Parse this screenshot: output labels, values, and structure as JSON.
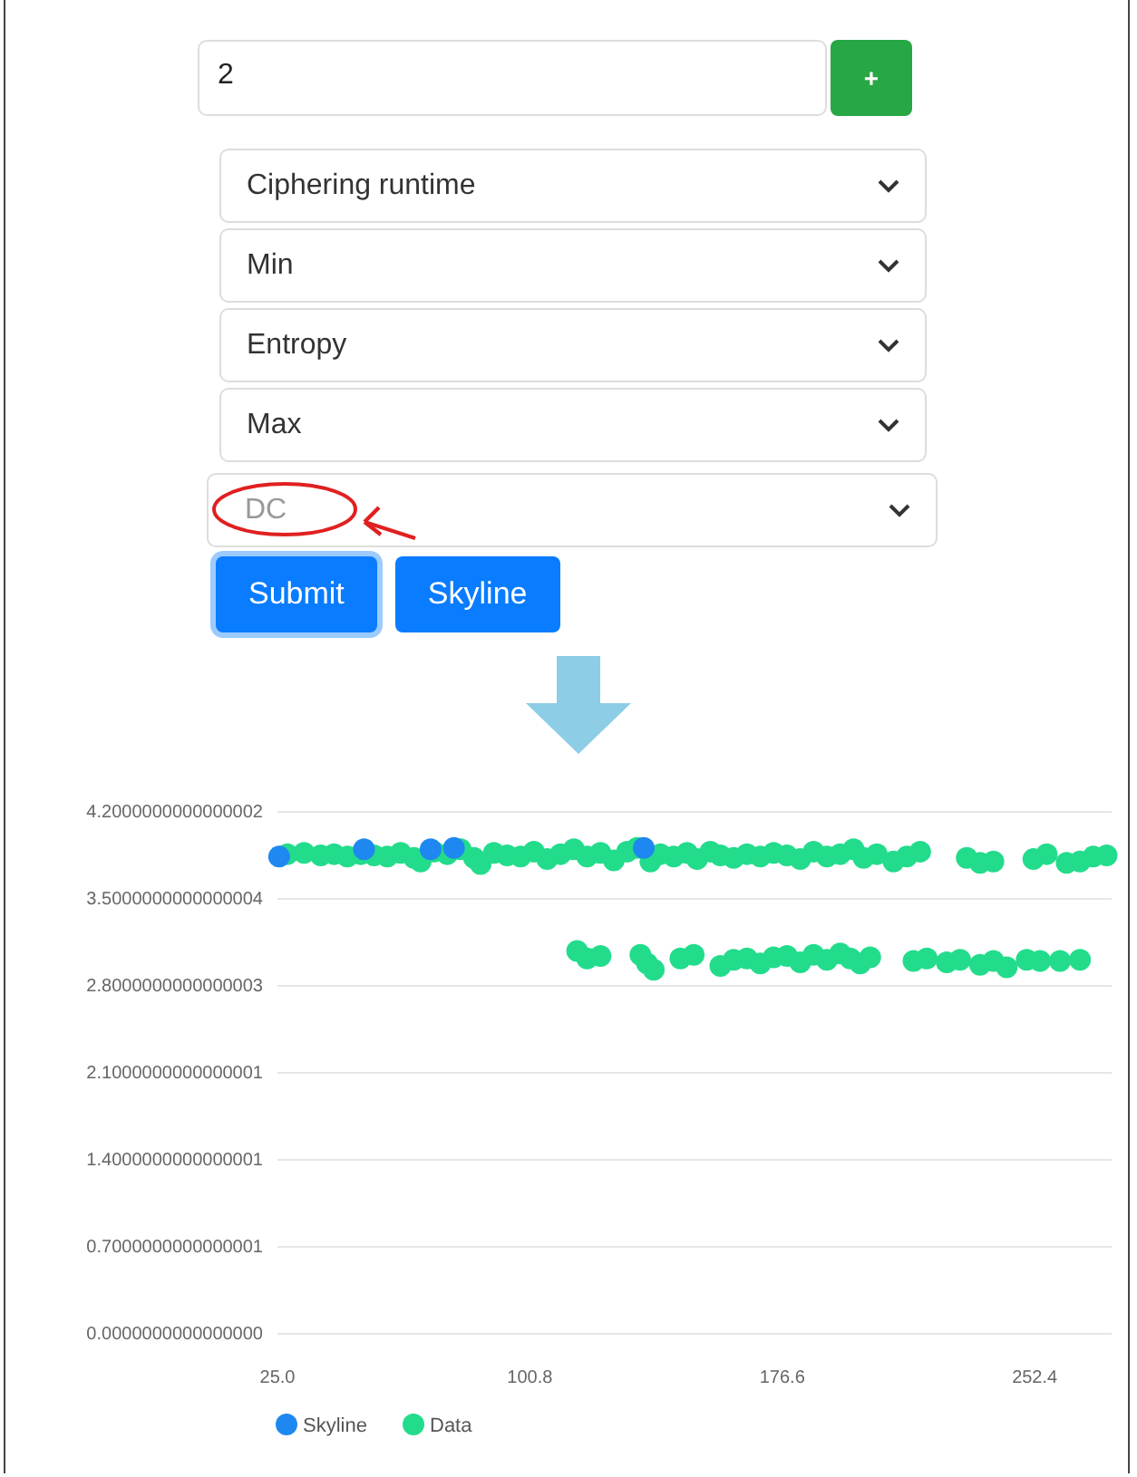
{
  "count_field": {
    "value": "2"
  },
  "add_button": {
    "label": "+"
  },
  "dropdowns": [
    {
      "value": "Ciphering runtime",
      "placeholder": false
    },
    {
      "value": "Min",
      "placeholder": false
    },
    {
      "value": "Entropy",
      "placeholder": false
    },
    {
      "value": "Max",
      "placeholder": false
    },
    {
      "value": "DC",
      "placeholder": true
    }
  ],
  "buttons": [
    {
      "label": "Submit",
      "focused": true
    },
    {
      "label": "Skyline",
      "focused": false
    }
  ],
  "chart_data": {
    "type": "scatter",
    "xlim": [
      25,
      275.5
    ],
    "ylim": [
      0,
      4.2
    ],
    "grid": true,
    "legend": "bottom",
    "xticks": [
      {
        "value": 25,
        "label": "25.0"
      },
      {
        "value": 100.8,
        "label": "100.8"
      },
      {
        "value": 176.6,
        "label": "176.6"
      },
      {
        "value": 252.4,
        "label": "252.4"
      }
    ],
    "yticks": [
      {
        "value": 4.2,
        "label": "4.2000000000000002"
      },
      {
        "value": 3.5,
        "label": "3.5000000000000004"
      },
      {
        "value": 2.8,
        "label": "2.8000000000000003"
      },
      {
        "value": 2.1,
        "label": "2.1000000000000001"
      },
      {
        "value": 1.4,
        "label": "1.4000000000000001"
      },
      {
        "value": 0.7,
        "label": "0.7000000000000001"
      },
      {
        "value": 0,
        "label": "0.0000000000000000"
      }
    ],
    "series": [
      {
        "name": "Skyline",
        "color": "#1e88f0",
        "x": [
          25.5,
          51,
          71,
          78,
          135
        ],
        "values": [
          3.84,
          3.9,
          3.9,
          3.91,
          3.91
        ]
      },
      {
        "name": "Data",
        "color": "#22dc8c",
        "x": [
          28,
          33,
          38,
          42,
          46,
          50,
          54,
          58,
          62,
          66,
          68,
          72,
          76,
          80,
          84,
          86,
          90,
          94,
          98,
          102,
          106,
          110,
          114,
          118,
          122,
          126,
          130,
          133,
          137,
          140,
          144,
          148,
          151,
          155,
          158,
          162,
          166,
          170,
          174,
          178,
          182,
          186,
          190,
          194,
          198,
          201,
          205,
          210,
          214,
          218,
          232,
          236,
          240,
          252,
          256,
          262,
          266,
          270,
          274,
          115,
          118,
          122,
          134,
          136,
          138,
          146,
          150,
          158,
          162,
          166,
          170,
          174,
          178,
          182,
          186,
          190,
          194,
          197,
          200,
          203,
          216,
          220,
          226,
          230,
          236,
          240,
          244,
          250,
          254,
          260,
          266
        ],
        "values": [
          3.86,
          3.87,
          3.85,
          3.86,
          3.84,
          3.86,
          3.85,
          3.84,
          3.87,
          3.83,
          3.8,
          3.88,
          3.86,
          3.9,
          3.83,
          3.78,
          3.87,
          3.85,
          3.84,
          3.88,
          3.82,
          3.86,
          3.9,
          3.84,
          3.87,
          3.81,
          3.88,
          3.91,
          3.8,
          3.86,
          3.84,
          3.87,
          3.82,
          3.88,
          3.85,
          3.83,
          3.86,
          3.84,
          3.87,
          3.85,
          3.82,
          3.88,
          3.84,
          3.86,
          3.9,
          3.83,
          3.86,
          3.8,
          3.84,
          3.88,
          3.83,
          3.79,
          3.8,
          3.82,
          3.86,
          3.79,
          3.8,
          3.84,
          3.85,
          3.08,
          3.02,
          3.04,
          3.05,
          2.98,
          2.93,
          3.02,
          3.05,
          2.96,
          3.01,
          3.02,
          2.98,
          3.03,
          3.04,
          2.99,
          3.05,
          3.01,
          3.06,
          3.02,
          2.98,
          3.03,
          3.0,
          3.02,
          2.99,
          3.01,
          2.97,
          3.0,
          2.95,
          3.01,
          3.0,
          3.0,
          3.01
        ]
      }
    ]
  }
}
